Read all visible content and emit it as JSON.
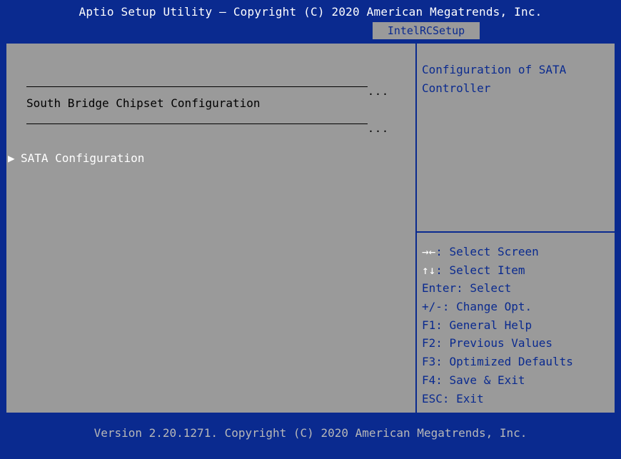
{
  "header": {
    "title": "Aptio Setup Utility – Copyright (C) 2020 American Megatrends, Inc.",
    "active_tab": "IntelRCSetup"
  },
  "main": {
    "separator_dots": "...",
    "section_title": "South Bridge Chipset Configuration",
    "items": [
      {
        "label": "SATA Configuration",
        "submenu_arrow": "▶"
      }
    ]
  },
  "help": {
    "description": "Configuration of SATA Controller"
  },
  "keys": [
    {
      "glyph": "→←",
      "text": ": Select Screen"
    },
    {
      "glyph": "↑↓",
      "text": ": Select Item"
    },
    {
      "glyph": "",
      "text": "Enter: Select"
    },
    {
      "glyph": "",
      "text": "+/-: Change Opt."
    },
    {
      "glyph": "",
      "text": "F1: General Help"
    },
    {
      "glyph": "",
      "text": "F2: Previous Values"
    },
    {
      "glyph": "",
      "text": "F3: Optimized Defaults"
    },
    {
      "glyph": "",
      "text": "F4: Save & Exit"
    },
    {
      "glyph": "",
      "text": "ESC: Exit"
    }
  ],
  "footer": {
    "version": "Version 2.20.1271. Copyright (C) 2020 American Megatrends, Inc."
  },
  "colors": {
    "background": "#0a2a8f",
    "panel": "#9a9a9a",
    "highlight_text": "#ffffff"
  }
}
